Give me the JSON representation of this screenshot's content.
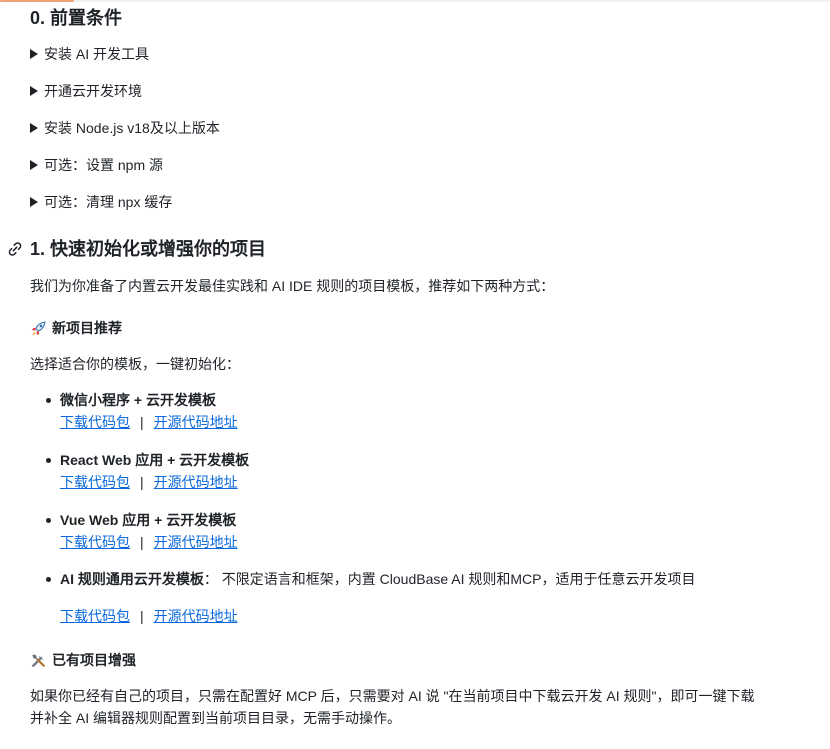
{
  "section0": {
    "title": "0. 前置条件",
    "details": [
      "安装 AI 开发工具",
      "开通云开发环境",
      "安装 Node.js v18及以上版本",
      "可选：设置 npm 源",
      "可选：清理 npx 缓存"
    ]
  },
  "section1": {
    "title": "1. 快速初始化或增强你的项目",
    "intro": "我们为你准备了内置云开发最佳实践和 AI IDE 规则的项目模板，推荐如下两种方式：",
    "new_project": {
      "icon": "rocket-icon",
      "heading": "新项目推荐",
      "intro": "选择适合你的模板，一键初始化：",
      "templates": [
        {
          "title": "微信小程序 + 云开发模板",
          "desc": "",
          "download": "下载代码包",
          "sep": "|",
          "source": "开源代码地址"
        },
        {
          "title": "React Web 应用 + 云开发模板",
          "desc": "",
          "download": "下载代码包",
          "sep": "|",
          "source": "开源代码地址"
        },
        {
          "title": "Vue Web 应用 + 云开发模板",
          "desc": "",
          "download": "下载代码包",
          "sep": "|",
          "source": "开源代码地址"
        },
        {
          "title": "AI 规则通用云开发模板",
          "desc": "： 不限定语言和框架，内置 CloudBase AI 规则和MCP，适用于任意云开发项目",
          "download": "下载代码包",
          "sep": "|",
          "source": "开源代码地址"
        }
      ]
    },
    "existing_project": {
      "icon": "tools-icon",
      "heading": "已有项目增强",
      "text_line1": "如果你已经有自己的项目，只需在配置好 MCP 后，只需要对 AI 说 \"在当前项目中下载云开发 AI 规则\"，即可一键下载",
      "text_line2": "并补全 AI 编辑器规则配置到当前项目目录，无需手动操作。"
    }
  },
  "colors": {
    "text": "#1f2328",
    "link": "#0969da",
    "accent": "#f0a37a"
  }
}
